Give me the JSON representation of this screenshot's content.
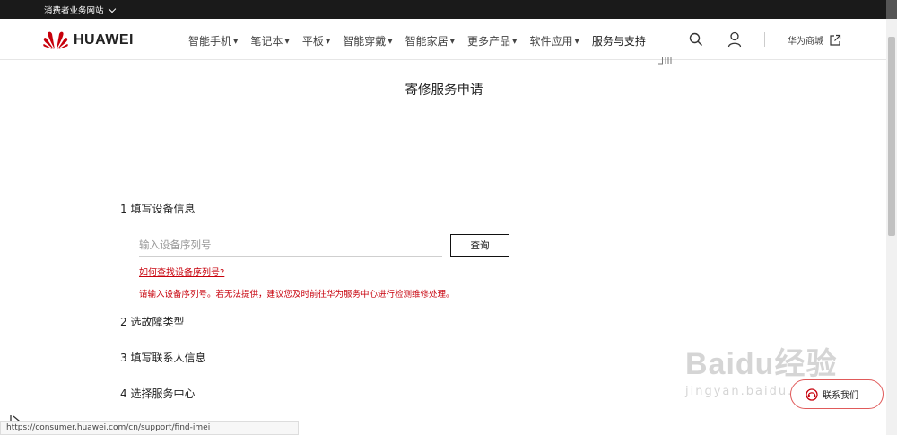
{
  "topbar": {
    "site_label": "消费者业务网站"
  },
  "brand": {
    "name": "HUAWEI",
    "color": "#c7000b"
  },
  "nav": {
    "items": [
      {
        "label": "智能手机",
        "dropdown": true
      },
      {
        "label": "笔记本",
        "dropdown": true
      },
      {
        "label": "平板",
        "dropdown": true
      },
      {
        "label": "智能穿戴",
        "dropdown": true
      },
      {
        "label": "智能家居",
        "dropdown": true
      },
      {
        "label": "更多产品",
        "dropdown": true
      },
      {
        "label": "软件应用",
        "dropdown": true
      },
      {
        "label": "服务与支持",
        "dropdown": false
      }
    ],
    "caret": "▼",
    "mall_label": "华为商城"
  },
  "page": {
    "title": "寄修服务申请"
  },
  "steps": {
    "s1": "1 填写设备信息",
    "s2": "2 选故障类型",
    "s3": "3 填写联系人信息",
    "s4": "4 选择服务中心"
  },
  "form": {
    "serial_placeholder": "输入设备序列号",
    "query_label": "查询",
    "help_link": "如何查找设备序列号?",
    "warning": "请输入设备序列号。若无法提供，建议您及时前往华为服务中心进行检测维修处理。"
  },
  "status_url": "https://consumer.huawei.com/cn/support/find-imei",
  "watermark": {
    "main": "Baidu经验",
    "sub": "jingyan.baidu.com"
  },
  "contact": {
    "label": "联系我们"
  },
  "colors": {
    "accent_red": "#c7000b",
    "topbar": "#1a1a1a"
  }
}
